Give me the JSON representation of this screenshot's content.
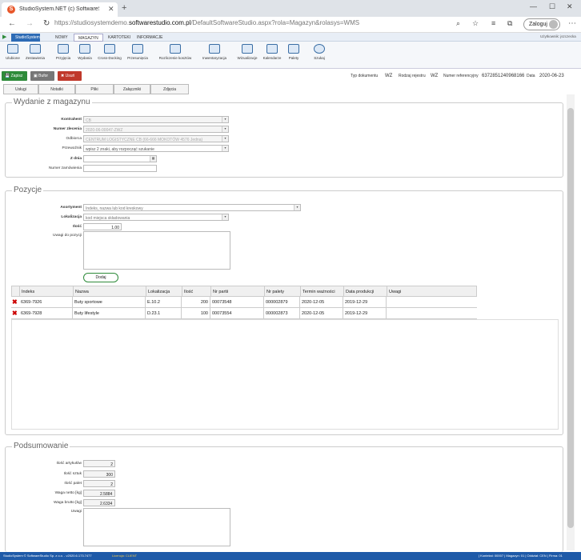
{
  "browser": {
    "tab_title": "StudioSystem.NET (c) SoftwareSt",
    "url_base": "https://studiosystemdemo.",
    "url_domain": "softwarestudio.com.pl",
    "url_path": "/DefaultSoftwareStudio.aspx?rola=Magazyn&rolasys=WMS",
    "login": "Zaloguj"
  },
  "menu": {
    "items": [
      "StudioSystem",
      "NOWY",
      "MAGAZYN",
      "KARTOTEKI",
      "INFORMACJE"
    ],
    "user": "Użytkownik: jszczecka"
  },
  "ribbon": [
    "Ulubione",
    "Zestawienia",
    "Przyjęcia",
    "Wydania",
    "Cross-Docking",
    "Przesunięcia",
    "Rozliczenie kosztów",
    "Inwentaryzacja",
    "Wizualizacje",
    "Kalendarze",
    "Palety",
    "Szukaj"
  ],
  "toolbar": {
    "save": "Zapisz",
    "bufor": "Bufor",
    "delete": "Usuń",
    "doc_type_label": "Typ dokumentu",
    "doc_type": "WZ",
    "register_label": "Rodzaj rejestru",
    "register": "WZ",
    "ref_label": "Numer referencyjny",
    "ref": "6372851240968166",
    "date_label": "Data",
    "date": "2020-06-23"
  },
  "subtabs": [
    "Usługi",
    "Notatki",
    "Pliki",
    "Załączniki",
    "Zdjęcia"
  ],
  "issue": {
    "legend": "Wydanie z magazynu",
    "contractor_label": "Kontrahent",
    "contractor": "CB",
    "order_label": "Numer zlecenia",
    "order": "2020-06-00047-ZWZ",
    "recipient_label": "Odbiorca",
    "recipient": "CENTRUM LOGISTYCZNE CB (66-666 MOKOTÓW 4576 Jedna)",
    "carrier_label": "Przewoźnik",
    "carrier_ph": "wpisz 2 znaki, aby rozpocząć szukanie",
    "date_label": "Z dnia",
    "orderno_label": "Numer zamówienia"
  },
  "positions": {
    "legend": "Pozycje",
    "assort_label": "Asortyment",
    "assort_ph": "Indeks, nazwa lub kod kreskowy",
    "loc_label": "Lokalizacja",
    "loc_ph": "kod miejsca składowania",
    "qty_label": "Ilość",
    "qty": "1.00",
    "notes_label": "Uwagi do pozycji",
    "add": "Dodaj"
  },
  "grid": {
    "headers": [
      "Indeks",
      "Nazwa",
      "Lokalizacja",
      "Ilość",
      "Nr partii",
      "Nr palety",
      "Termin ważności",
      "Data produkcji",
      "Uwagi"
    ],
    "rows": [
      [
        "6369-7926",
        "Buty sportowe",
        "E.10.2",
        "200",
        "00073548",
        "000002879",
        "2020-12-05",
        "2019-12-29",
        ""
      ],
      [
        "6369-7928",
        "Buty lifestyle",
        "D.23.1",
        "100",
        "00073554",
        "000002873",
        "2020-12-05",
        "2019-12-29",
        ""
      ]
    ]
  },
  "summary": {
    "legend": "Podsumowanie",
    "items": [
      {
        "label": "Ilość artykułów",
        "value": "2"
      },
      {
        "label": "Ilość sztuk",
        "value": "300"
      },
      {
        "label": "Ilość palet",
        "value": "2"
      },
      {
        "label": "Waga netto [kg]",
        "value": "2.5884"
      },
      {
        "label": "Waga brutto [kg]",
        "value": "2.6334"
      }
    ],
    "notes_label": "Uwagi"
  },
  "status": {
    "left": "StudioSystem © SoftwareStudio Sp. z o.o. - v2020.6.173.7477",
    "license": "Licencja: CLIENT",
    "right": "| Kontekst: 00007 | Magazyn: 01 | Oddział: CEN | Firma: 01"
  }
}
